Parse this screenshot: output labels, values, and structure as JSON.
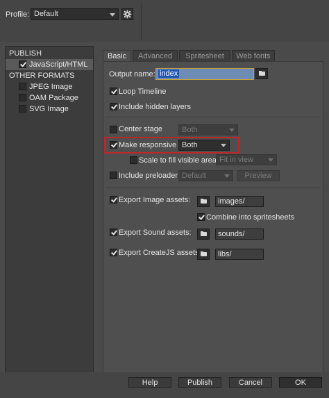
{
  "header": {
    "profile_label": "Profile:",
    "profile_value": "Default",
    "gear_icon": "gear-icon"
  },
  "sidebar": {
    "publish_header": "PUBLISH",
    "publish_items": [
      {
        "label": "JavaScript/HTML",
        "checked": true,
        "selected": true
      }
    ],
    "other_header": "OTHER FORMATS",
    "other_items": [
      {
        "label": "JPEG Image",
        "checked": false
      },
      {
        "label": "OAM Package",
        "checked": false
      },
      {
        "label": "SVG Image",
        "checked": false
      }
    ]
  },
  "tabs": [
    {
      "label": "Basic",
      "active": true
    },
    {
      "label": "Advanced",
      "active": false
    },
    {
      "label": "Spritesheet",
      "active": false
    },
    {
      "label": "Web fonts",
      "active": false
    }
  ],
  "basic": {
    "output_name_label": "Output name:",
    "output_name_value": "index",
    "loop_timeline": {
      "label": "Loop Timeline",
      "checked": true
    },
    "include_hidden_layers": {
      "label": "Include hidden layers",
      "checked": true
    },
    "center_stage": {
      "label": "Center stage",
      "checked": false,
      "dropdown": "Both"
    },
    "make_responsive": {
      "label": "Make responsive",
      "checked": true,
      "dropdown": "Both"
    },
    "scale_to_fill": {
      "label": "Scale to fill visible area",
      "checked": false,
      "dropdown": "Fit in view"
    },
    "include_preloader": {
      "label": "Include preloader",
      "checked": false,
      "dropdown": "Default",
      "preview_label": "Preview"
    },
    "export_image": {
      "label": "Export Image assets:",
      "checked": true,
      "path": "images/"
    },
    "combine_spritesheets": {
      "label": "Combine into spritesheets",
      "checked": true
    },
    "export_sound": {
      "label": "Export Sound assets:",
      "checked": true,
      "path": "sounds/"
    },
    "export_createjs": {
      "label": "Export CreateJS assets:",
      "checked": true,
      "path": "libs/"
    }
  },
  "footer": {
    "help": "Help",
    "publish": "Publish",
    "cancel": "Cancel",
    "ok": "OK"
  },
  "colors": {
    "highlight_border": "#c0252a",
    "panel_bg": "#4f4f4f"
  }
}
